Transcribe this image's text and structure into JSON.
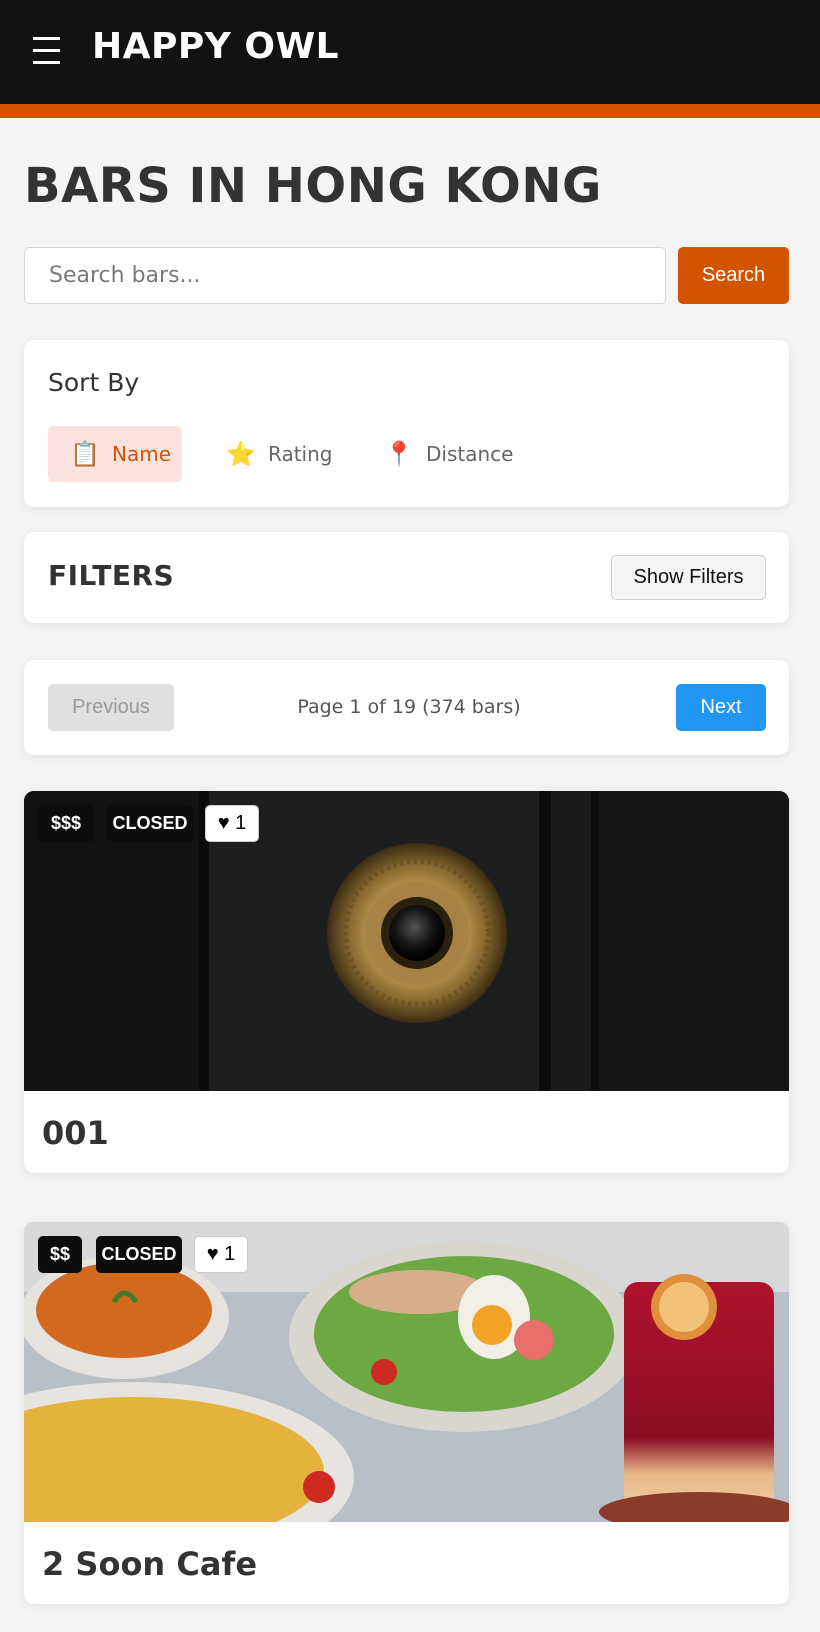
{
  "header": {
    "brand": "HAPPY OWL",
    "menu_icon": "hamburger-icon",
    "bg_color": "#121212",
    "accent_color": "#d35400"
  },
  "page": {
    "title": "BARS IN HONG KONG"
  },
  "search": {
    "placeholder": "Search bars...",
    "value": "",
    "button_label": "Search"
  },
  "sort": {
    "title": "Sort By",
    "options": [
      {
        "label": "Name",
        "icon": "clipboard-icon",
        "glyph": "📋",
        "active": true
      },
      {
        "label": "Rating",
        "icon": "star-icon",
        "glyph": "⭐",
        "active": false
      },
      {
        "label": "Distance",
        "icon": "pin-icon",
        "glyph": "📍",
        "active": false
      }
    ]
  },
  "filters": {
    "title": "FILTERS",
    "toggle_label": "Show Filters"
  },
  "pagination": {
    "previous_label": "Previous",
    "next_label": "Next",
    "info": "Page 1 of 19 (374 bars)"
  },
  "bars": [
    {
      "name": "001",
      "price": "$$$",
      "status": "CLOSED",
      "likes": "♥ 1"
    },
    {
      "name": "2 Soon Cafe",
      "price": "$$",
      "status": "CLOSED",
      "likes": "♥ 1"
    }
  ]
}
